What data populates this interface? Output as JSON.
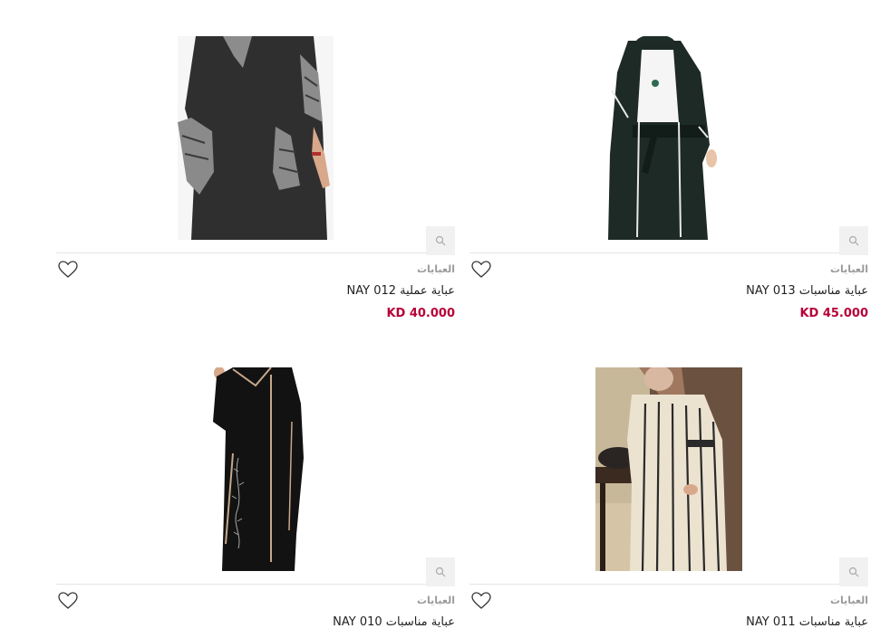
{
  "products": [
    {
      "category": "العبايات",
      "name": "عباية مناسبات NAY 013",
      "price": "KD 45.000",
      "image": "black abaya with white trim worn over white top"
    },
    {
      "category": "العبايات",
      "name": "عباية عملية NAY 012",
      "price": "KD 40.000",
      "image": "black abaya with patterned grey sleeves and pockets"
    },
    {
      "category": "العبايات",
      "name": "عباية مناسبات NAY 011",
      "price": "",
      "image": "beige abaya with black vertical stripes"
    },
    {
      "category": "العبايات",
      "name": "عباية مناسبات NAY 010",
      "price": "",
      "image": "black abaya with beige piping and embroidery"
    }
  ],
  "icons": {
    "wishlist": "heart-outline-icon",
    "quick_view": "search-icon"
  },
  "colors": {
    "price": "#b7003a",
    "category": "#9a9a9a",
    "quick_view_bg": "#f1f1f1"
  }
}
